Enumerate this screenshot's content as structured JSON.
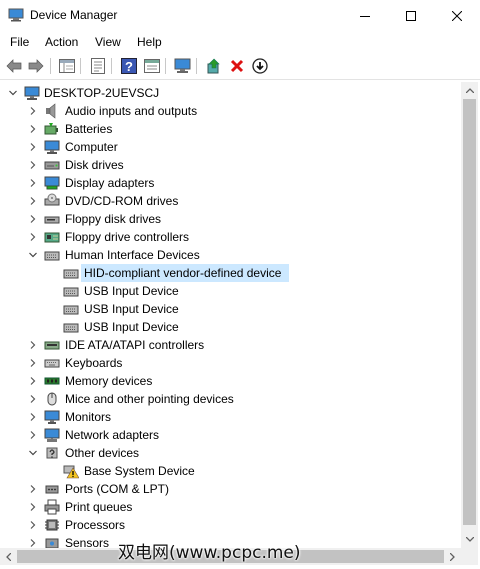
{
  "window": {
    "title": "Device Manager",
    "controls": {
      "minimize": "─",
      "maximize": "☐",
      "close": "✕"
    }
  },
  "menu": [
    "File",
    "Action",
    "View",
    "Help"
  ],
  "toolbar": {
    "buttons": [
      "back-icon",
      "forward-icon",
      "show-hide-tree-icon",
      "properties-icon",
      "help-icon",
      "resources-icon",
      "scan-hardware-icon",
      "update-driver-icon",
      "uninstall-icon",
      "disable-icon"
    ],
    "accent_colors": {
      "back_forward": "#6b6b6b",
      "help": "#3a57b3",
      "uninstall": "#d11",
      "update": "#2a9a2a"
    }
  },
  "tree": {
    "root": "DESKTOP-2UEVSCJ",
    "items": [
      {
        "label": "Audio inputs and outputs",
        "icon": "speaker-icon",
        "expanded": false,
        "level": 1
      },
      {
        "label": "Batteries",
        "icon": "battery-icon",
        "expanded": false,
        "level": 1
      },
      {
        "label": "Computer",
        "icon": "computer-icon",
        "expanded": false,
        "level": 1
      },
      {
        "label": "Disk drives",
        "icon": "disk-drive-icon",
        "expanded": false,
        "level": 1
      },
      {
        "label": "Display adapters",
        "icon": "display-adapter-icon",
        "expanded": false,
        "level": 1
      },
      {
        "label": "DVD/CD-ROM drives",
        "icon": "dvd-drive-icon",
        "expanded": false,
        "level": 1
      },
      {
        "label": "Floppy disk drives",
        "icon": "floppy-disk-icon",
        "expanded": false,
        "level": 1
      },
      {
        "label": "Floppy drive controllers",
        "icon": "floppy-controller-icon",
        "expanded": false,
        "level": 1
      },
      {
        "label": "Human Interface Devices",
        "icon": "hid-icon",
        "expanded": true,
        "level": 1
      },
      {
        "label": "HID-compliant vendor-defined device",
        "icon": "hid-device-icon",
        "level": 2,
        "selected": true
      },
      {
        "label": "USB Input Device",
        "icon": "hid-device-icon",
        "level": 2
      },
      {
        "label": "USB Input Device",
        "icon": "hid-device-icon",
        "level": 2
      },
      {
        "label": "USB Input Device",
        "icon": "hid-device-icon",
        "level": 2
      },
      {
        "label": "IDE ATA/ATAPI controllers",
        "icon": "ide-controller-icon",
        "expanded": false,
        "level": 1
      },
      {
        "label": "Keyboards",
        "icon": "keyboard-icon",
        "expanded": false,
        "level": 1
      },
      {
        "label": "Memory devices",
        "icon": "memory-icon",
        "expanded": false,
        "level": 1
      },
      {
        "label": "Mice and other pointing devices",
        "icon": "mouse-icon",
        "expanded": false,
        "level": 1
      },
      {
        "label": "Monitors",
        "icon": "monitor-icon",
        "expanded": false,
        "level": 1
      },
      {
        "label": "Network adapters",
        "icon": "network-adapter-icon",
        "expanded": false,
        "level": 1
      },
      {
        "label": "Other devices",
        "icon": "other-devices-icon",
        "expanded": true,
        "level": 1
      },
      {
        "label": "Base System Device",
        "icon": "warning-device-icon",
        "level": 2
      },
      {
        "label": "Ports (COM & LPT)",
        "icon": "port-icon",
        "expanded": false,
        "level": 1
      },
      {
        "label": "Print queues",
        "icon": "printer-icon",
        "expanded": false,
        "level": 1
      },
      {
        "label": "Processors",
        "icon": "processor-icon",
        "expanded": false,
        "level": 1
      },
      {
        "label": "Sensors",
        "icon": "sensor-icon",
        "expanded": false,
        "level": 1
      }
    ]
  },
  "watermark": "双电网(www.pcpc.me)",
  "colors": {
    "selection": "#cce8ff",
    "scroll_track": "#f0f0f0",
    "scroll_thumb": "#c2c2c2"
  }
}
